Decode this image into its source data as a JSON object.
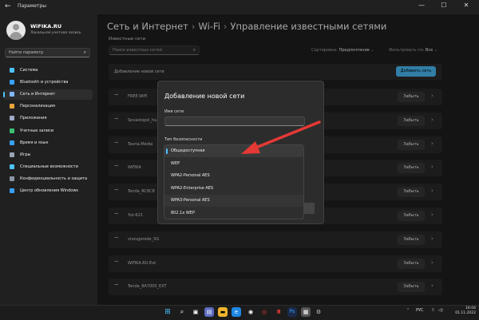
{
  "window": {
    "title": "Параметры"
  },
  "account": {
    "name": "WiFIKA.RU",
    "type": "Локальная учетная запись"
  },
  "sidebar": {
    "search_placeholder": "Найти параметр",
    "items": [
      {
        "label": "Система",
        "icon": "monitor-icon",
        "color": "#4cc2ff"
      },
      {
        "label": "Bluetooth и устройства",
        "icon": "bluetooth-icon",
        "color": "#3aa0ff"
      },
      {
        "label": "Сеть и Интернет",
        "icon": "network-icon",
        "color": "#7fb7ff"
      },
      {
        "label": "Персонализация",
        "icon": "brush-icon",
        "color": "#e8a33c"
      },
      {
        "label": "Приложения",
        "icon": "apps-icon",
        "color": "#9fa9c7"
      },
      {
        "label": "Учетные записи",
        "icon": "user-icon",
        "color": "#38c172"
      },
      {
        "label": "Время и язык",
        "icon": "globe-clock-icon",
        "color": "#3aa0ff"
      },
      {
        "label": "Игры",
        "icon": "gamepad-icon",
        "color": "#9aa3b5"
      },
      {
        "label": "Специальные возможности",
        "icon": "accessibility-icon",
        "color": "#4cc2ff"
      },
      {
        "label": "Конфиденциальность и защита",
        "icon": "shield-icon",
        "color": "#8a96a8"
      },
      {
        "label": "Центр обновления Windows",
        "icon": "update-icon",
        "color": "#3aa0ff"
      }
    ],
    "active_index": 2
  },
  "breadcrumb": {
    "part1": "Сеть и Интернет",
    "sep": "›",
    "part2": "Wi-Fi",
    "part3": "Управление известными сетями"
  },
  "known_networks": {
    "title": "Известные сети",
    "search_placeholder": "Поиск известных сетей",
    "sort_label": "Сортировка:",
    "sort_value": "Предпочтение",
    "filter_label": "Фильтровать по:",
    "filter_value": "Все",
    "add_label": "Добавление новой сети",
    "add_button": "Добавить сеть",
    "forget_label": "Забыть",
    "networks": [
      "FREE-WiFi",
      "Sevastopol_hu",
      "Tavria.Media",
      "WiFiKA",
      "Tenda_RC8C8",
      "Yut-621",
      "vnovgorode_5G",
      "WiFiKA.RU-Ext",
      "Tenda_8A7000_EXT"
    ]
  },
  "dialog": {
    "title": "Добавление новой сети",
    "name_label": "Имя сети",
    "security_label": "Тип безопасности",
    "options": [
      "Общедоступная",
      "WEP",
      "WPA2-Personal AES",
      "WPA2-Enterprise AES",
      "WPA3-Personal AES",
      "802.1x WEP"
    ],
    "selected_index": 0,
    "highlighted_index": 4
  },
  "taskbar": {
    "lang": "РУС",
    "time": "16:04",
    "date": "01.11.2022"
  },
  "colors": {
    "accent": "#4cc2ff",
    "arrow": "#e53935"
  }
}
